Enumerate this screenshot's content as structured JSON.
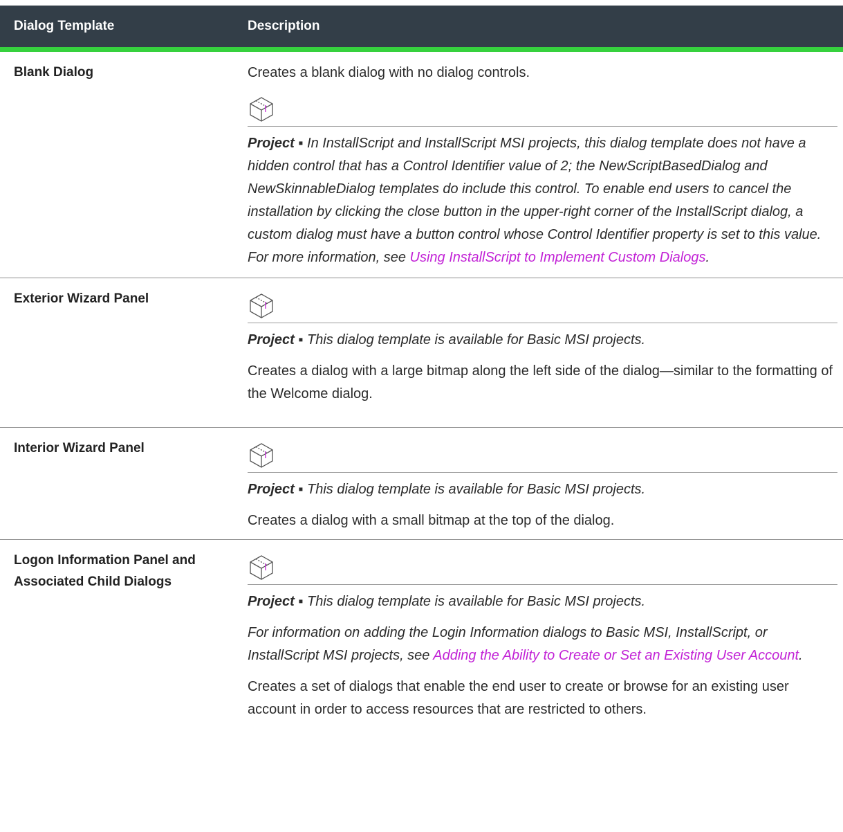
{
  "table": {
    "headers": [
      "Dialog Template",
      "Description"
    ],
    "rows": [
      {
        "name": "Blank Dialog",
        "intro": "Creates a blank dialog with no dialog controls.",
        "note_label": "Project ▪",
        "note_text": " In InstallScript and InstallScript MSI projects, this dialog template does not have a hidden control that has a Control Identifier value of 2; the NewScriptBasedDialog and NewSkinnableDialog templates do include this control. To enable end users to cancel the installation by clicking the close button in the upper-right corner of the InstallScript dialog, a custom dialog must have a button control whose Control Identifier property is set to this value. For more information, see ",
        "note_link": "Using InstallScript to Implement Custom Dialogs",
        "note_end": "."
      },
      {
        "name": "Exterior Wizard Panel",
        "note_label": "Project ▪",
        "note_text": " This dialog template is available for Basic MSI projects.",
        "desc": "Creates a dialog with a large bitmap along the left side of the dialog—similar to the formatting of the Welcome dialog."
      },
      {
        "name": "Interior Wizard Panel",
        "note_label": "Project ▪",
        "note_text": " This dialog template is available for Basic MSI projects.",
        "desc": "Creates a dialog with a small bitmap at the top of the dialog."
      },
      {
        "name": "Logon Information Panel and Associated Child Dialogs",
        "note_label": "Project ▪",
        "note_text": " This dialog template is available for Basic MSI projects.",
        "info_text": "For information on adding the Login Information dialogs to Basic MSI, InstallScript, or InstallScript MSI projects, see ",
        "info_link": "Adding the Ability to Create or Set an Existing User Account",
        "info_end": ".",
        "desc": "Creates a set of dialogs that enable the end user to create or browse for an existing user account in order to access resources that are restricted to others."
      }
    ]
  },
  "icons": {
    "project": "project-box-icon"
  },
  "colors": {
    "header_bg": "#333e48",
    "accent": "#36d13e",
    "link": "#c222d6"
  }
}
